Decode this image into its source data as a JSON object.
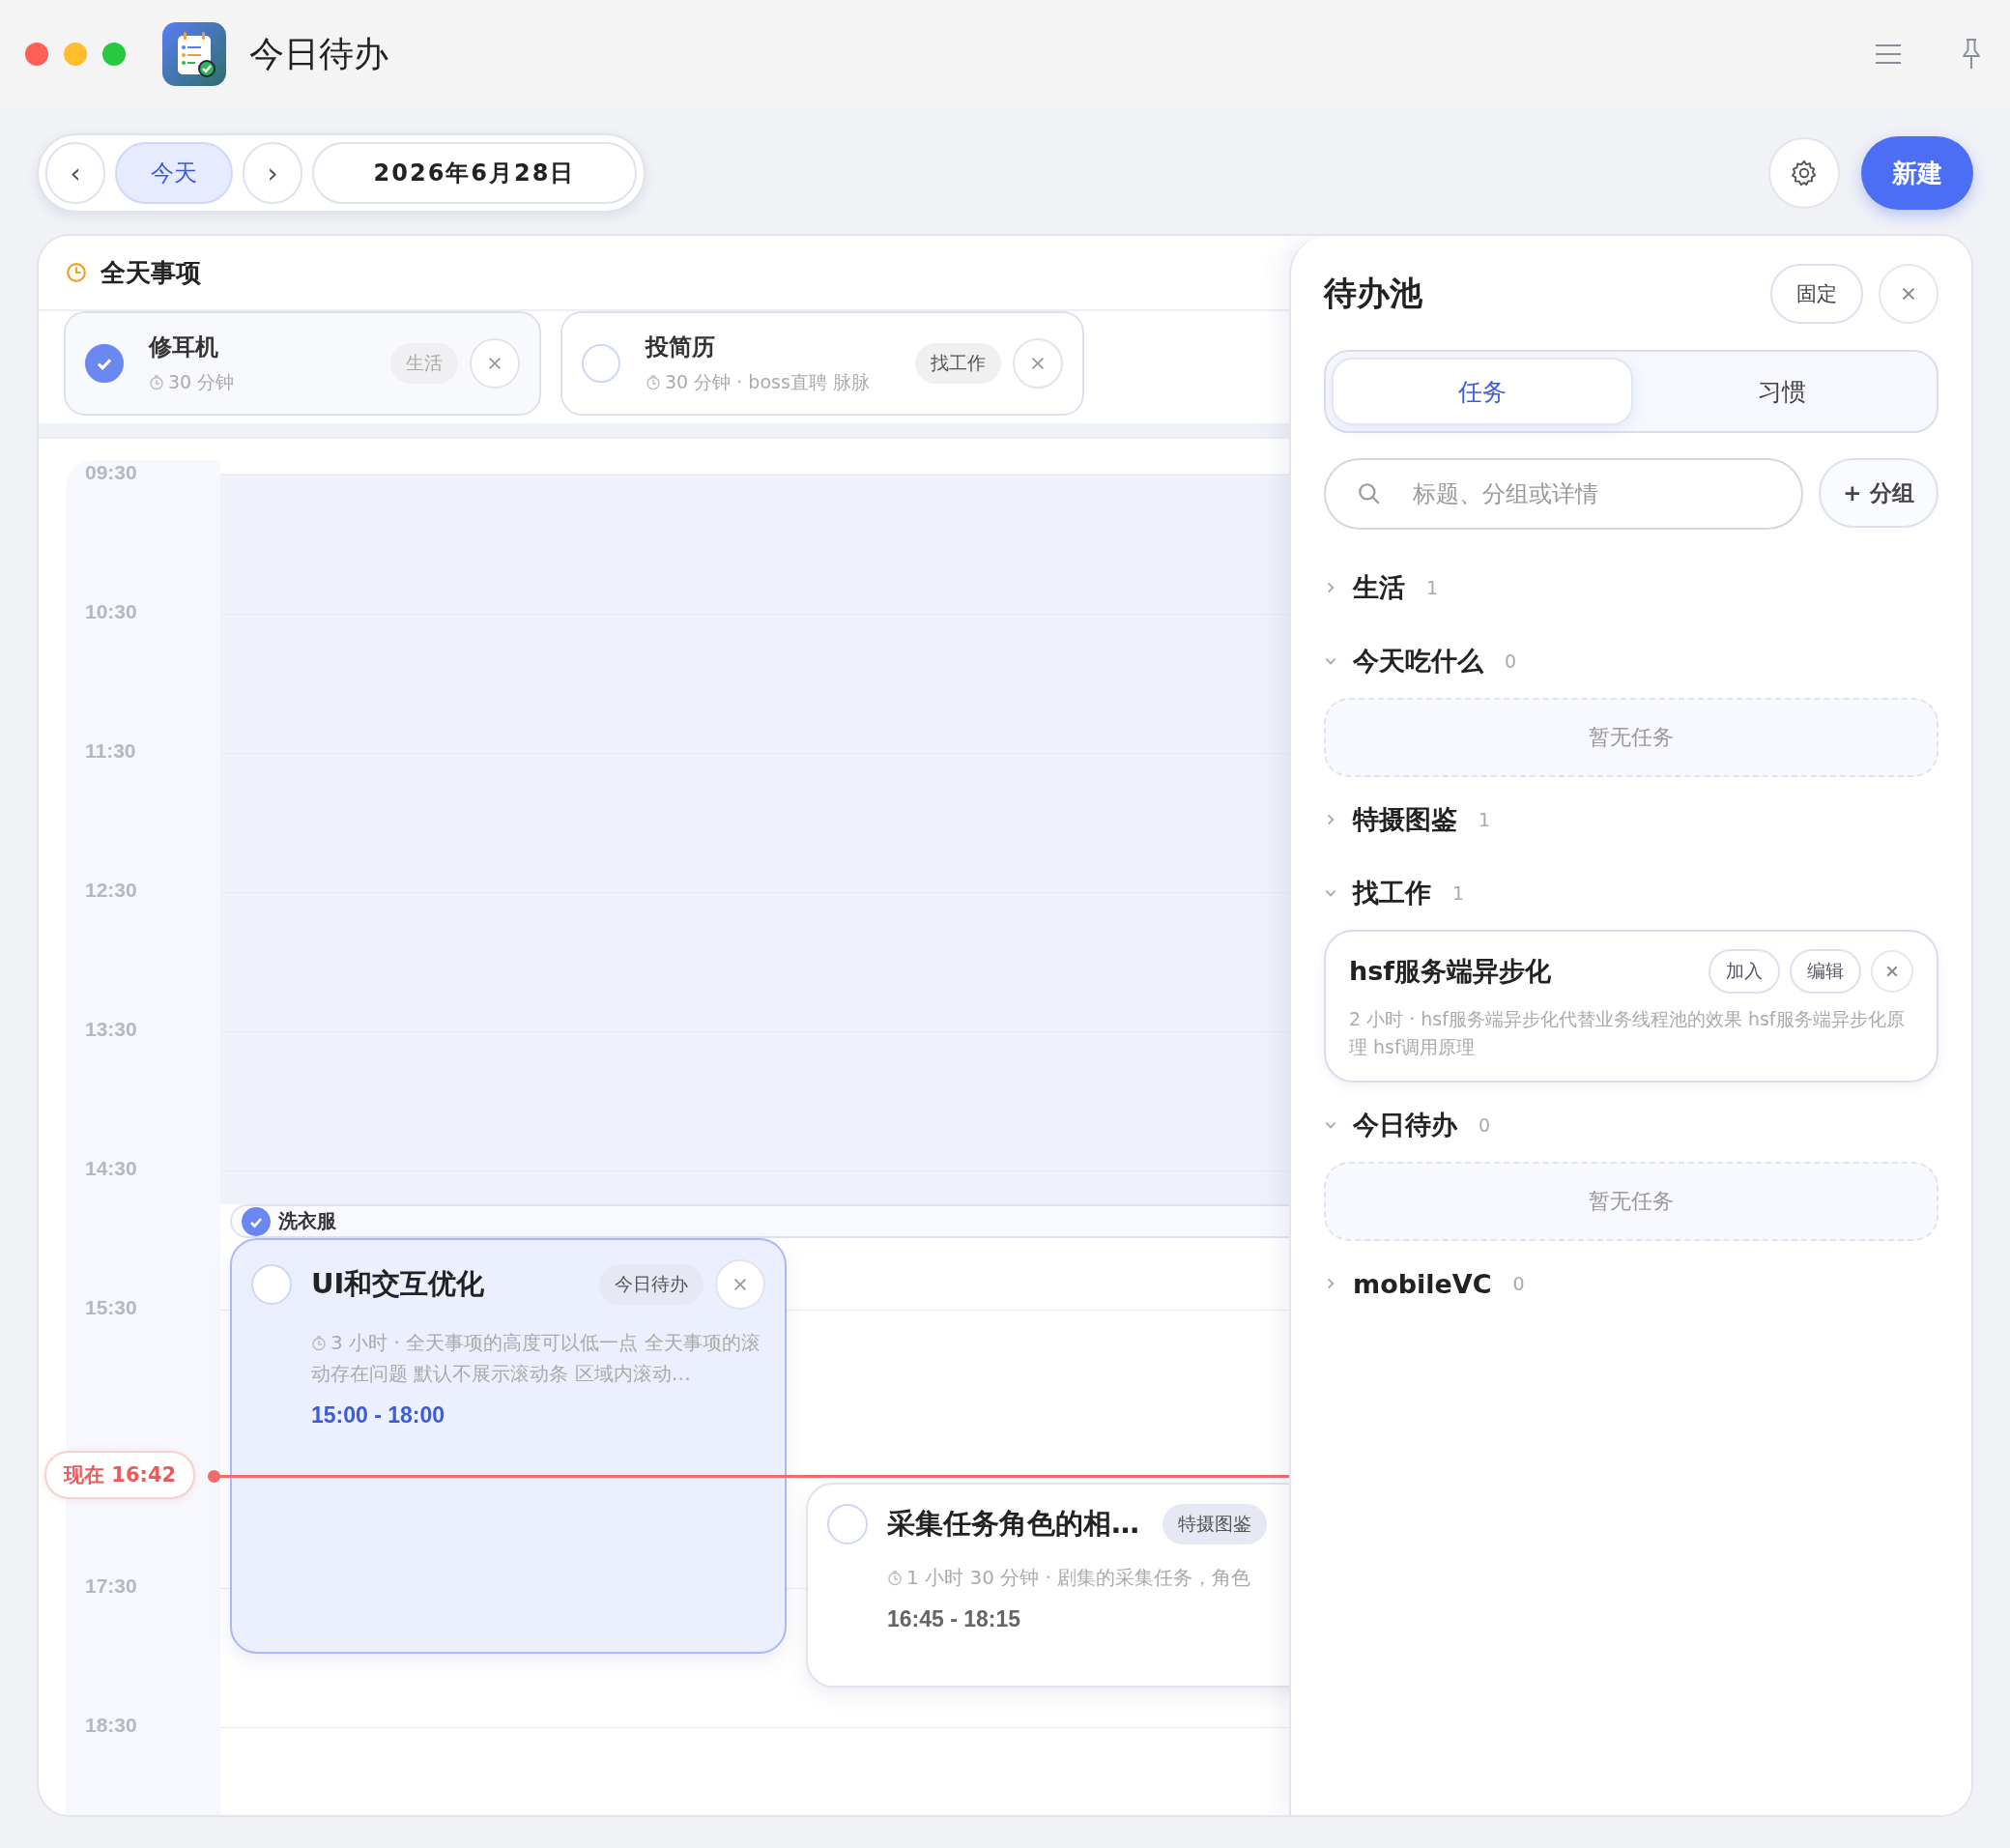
{
  "window": {
    "title": "今日待办"
  },
  "toolbar": {
    "prev": "‹",
    "today": {
      "label": "今天",
      "selected": true
    },
    "next": "›",
    "date": "2026年6月28日",
    "new_button": "新建"
  },
  "all_day": {
    "title": "全天事项",
    "items": [
      {
        "title": "修耳机",
        "done": true,
        "meta": "30 分钟",
        "tag": "生活"
      },
      {
        "title": "投简历",
        "done": false,
        "meta": "30 分钟 · boss直聘 脉脉",
        "tag": "找工作"
      }
    ]
  },
  "timeline": {
    "rows": [
      {
        "kind": "time",
        "label": "09:30"
      },
      {
        "kind": "time",
        "label": "10:30"
      },
      {
        "kind": "time",
        "label": "11:30"
      },
      {
        "kind": "time",
        "label": "12:30"
      },
      {
        "kind": "time",
        "label": "13:30"
      },
      {
        "kind": "time",
        "label": "14:30"
      },
      {
        "kind": "time",
        "label": "15:30"
      },
      {
        "kind": "now",
        "label": "现在 16:42"
      },
      {
        "kind": "time",
        "label": "17:30"
      },
      {
        "kind": "time",
        "label": "18:30"
      }
    ],
    "events": [
      {
        "kind": "bar",
        "title": "洗衣服",
        "done": true
      },
      {
        "kind": "card",
        "title": "UI和交互优化",
        "done": false,
        "selected": true,
        "tag": "今日待办",
        "meta": "3 小时 · 全天事项的高度可以低一点 全天事项的滚动存在问题 默认不展示滚动条 区域内滚动…",
        "time": "15:00 - 18:00"
      },
      {
        "kind": "card",
        "title": "采集任务角色的相…",
        "done": false,
        "selected": false,
        "tag": "特摄图鉴",
        "meta": "1 小时 30 分钟 · 剧集的采集任务，角色",
        "time": "16:45 - 18:15"
      }
    ]
  },
  "pool": {
    "title": "待办池",
    "pin_button": "固定",
    "tabs": [
      {
        "label": "任务",
        "selected": true
      },
      {
        "label": "习惯",
        "selected": false
      }
    ],
    "search": {
      "placeholder": "标题、分组或详情"
    },
    "add_group": "+ 分组",
    "groups": [
      {
        "name": "生活",
        "count": "1",
        "expanded": false
      },
      {
        "name": "今天吃什么",
        "count": "0",
        "expanded": true,
        "empty_text": "暂无任务"
      },
      {
        "name": "特摄图鉴",
        "count": "1",
        "expanded": false
      },
      {
        "name": "找工作",
        "count": "1",
        "expanded": true,
        "tasks": [
          {
            "title": "hsf服务端异步化",
            "meta": "2 小时 · hsf服务端异步化代替业务线程池的效果 hsf服务端异步化原理 hsf调用原理",
            "buttons": [
              "加入",
              "编辑"
            ]
          }
        ]
      },
      {
        "name": "今日待办",
        "count": "0",
        "expanded": true,
        "empty_text": "暂无任务"
      },
      {
        "name": "mobileVC",
        "count": "0",
        "expanded": false
      }
    ]
  }
}
